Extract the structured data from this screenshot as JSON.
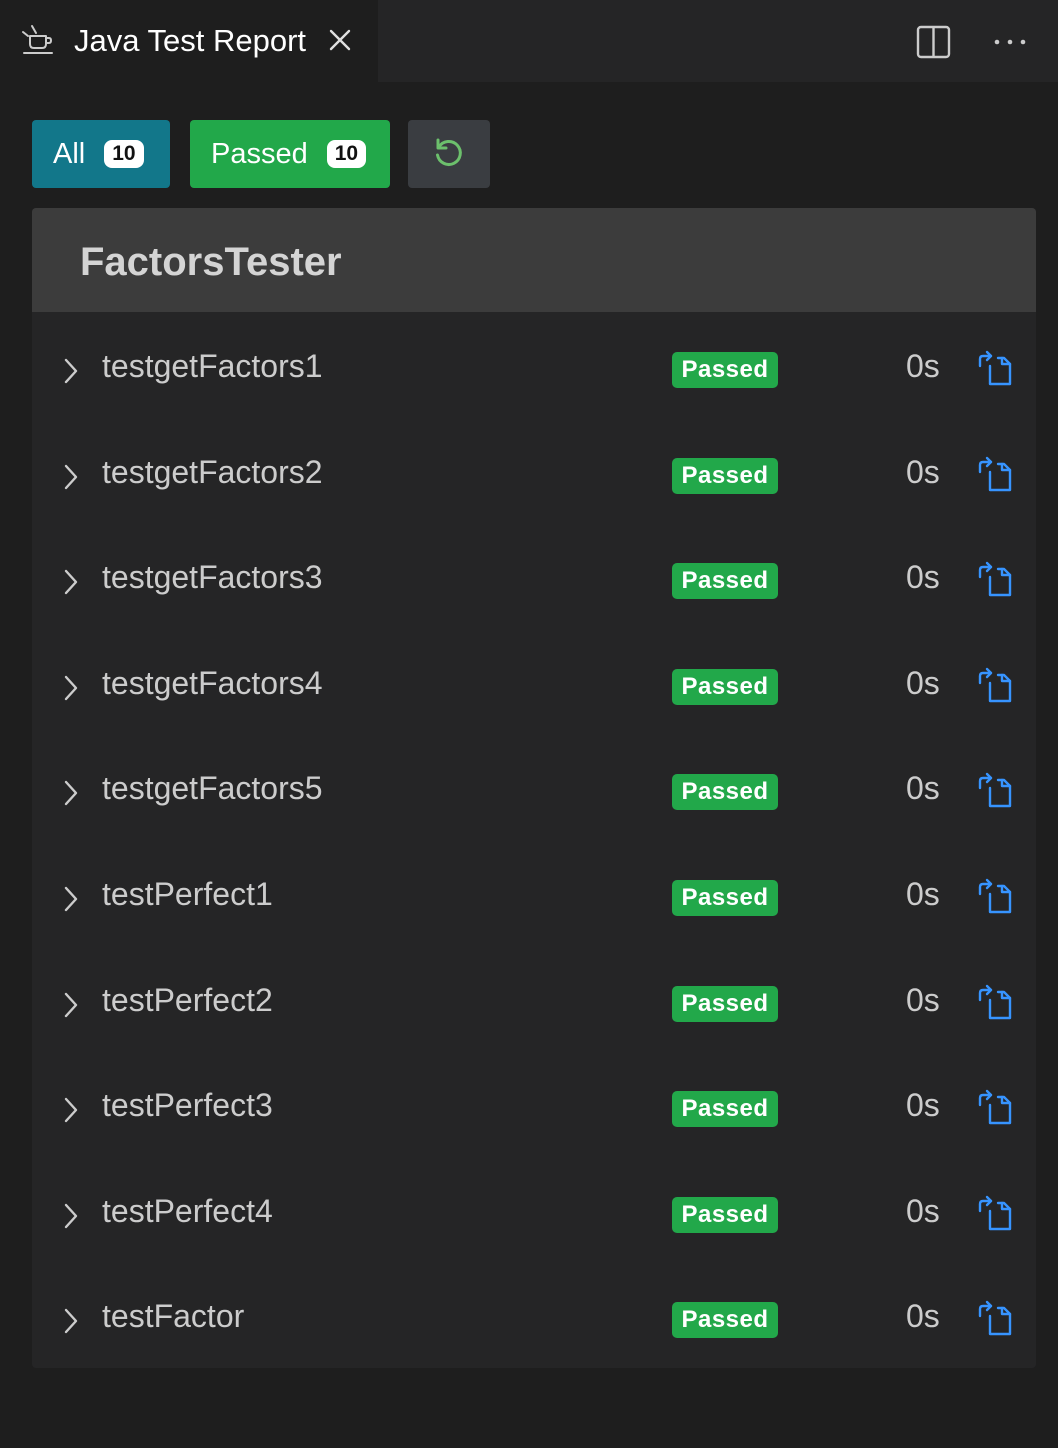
{
  "tab": {
    "icon": "beaker-icon",
    "title": "Java Test Report",
    "close_icon": "close-icon"
  },
  "toolbar": {
    "split_icon": "split-editor-icon",
    "more_icon": "more-actions-icon"
  },
  "filters": {
    "all_label": "All",
    "all_count": "10",
    "passed_label": "Passed",
    "passed_count": "10",
    "rerun_icon": "rerun-icon"
  },
  "suite": {
    "title": "FactorsTester",
    "tests": [
      {
        "name": "testgetFactors1",
        "status": "Passed",
        "duration": "0s"
      },
      {
        "name": "testgetFactors2",
        "status": "Passed",
        "duration": "0s"
      },
      {
        "name": "testgetFactors3",
        "status": "Passed",
        "duration": "0s"
      },
      {
        "name": "testgetFactors4",
        "status": "Passed",
        "duration": "0s"
      },
      {
        "name": "testgetFactors5",
        "status": "Passed",
        "duration": "0s"
      },
      {
        "name": "testPerfect1",
        "status": "Passed",
        "duration": "0s"
      },
      {
        "name": "testPerfect2",
        "status": "Passed",
        "duration": "0s"
      },
      {
        "name": "testPerfect3",
        "status": "Passed",
        "duration": "0s"
      },
      {
        "name": "testPerfect4",
        "status": "Passed",
        "duration": "0s"
      },
      {
        "name": "testFactor",
        "status": "Passed",
        "duration": "0s"
      }
    ]
  },
  "colors": {
    "all_filter": "#12778a",
    "passed": "#22a84a",
    "link_icon": "#3794ff",
    "rerun_icon": "#6cc06c"
  }
}
